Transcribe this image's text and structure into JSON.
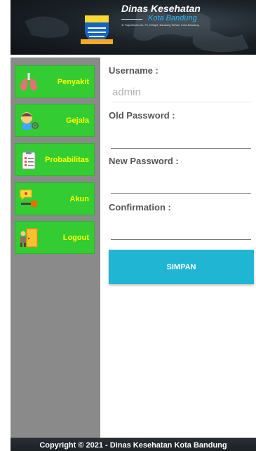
{
  "header": {
    "title": "Dinas Kesehatan",
    "subtitle": "Kota Bandung",
    "address": "Jl. Supratman No. 73, Cihapit, Bandung Wetan, Kota Bandung"
  },
  "sidebar": {
    "items": [
      {
        "label": "Penyakit",
        "icon": "lungs-icon"
      },
      {
        "label": "Gejala",
        "icon": "sick-person-icon"
      },
      {
        "label": "Probabilitas",
        "icon": "clipboard-icon"
      },
      {
        "label": "Akun",
        "icon": "key-icon"
      },
      {
        "label": "Logout",
        "icon": "exit-door-icon"
      }
    ]
  },
  "form": {
    "username_label": "Username :",
    "username_value": "admin",
    "old_password_label": "Old Password :",
    "old_password_value": "",
    "new_password_label": "New Password :",
    "new_password_value": "",
    "confirmation_label": "Confirmation :",
    "confirmation_value": "",
    "submit_label": "SIMPAN"
  },
  "footer": {
    "text": "Copyright © 2021 - Dinas Kesehatan Kota Bandung"
  },
  "colors": {
    "sidebar_bg": "#8a8a8a",
    "nav_button": "#33cc33",
    "nav_label": "#ffff00",
    "submit_button": "#1fb5d3",
    "header_bg": "#1c2329"
  }
}
